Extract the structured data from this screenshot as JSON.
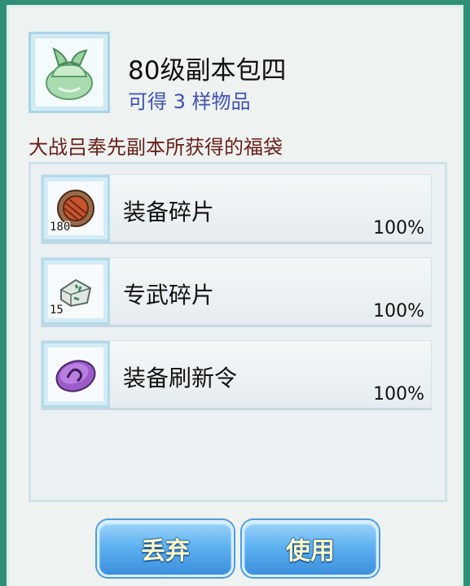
{
  "item": {
    "title": "80级副本包四",
    "count_text": "可得 3 样物品",
    "description": "大战吕奉先副本所获得的福袋",
    "icon": "green-cloth-bag-icon"
  },
  "rewards": [
    {
      "name": "装备碎片",
      "quantity": "180",
      "chance": "100%",
      "icon": "equipment-shard-icon"
    },
    {
      "name": "专武碎片",
      "quantity": "15",
      "chance": "100%",
      "icon": "exclusive-weapon-shard-icon"
    },
    {
      "name": "装备刷新令",
      "quantity": "",
      "chance": "100%",
      "icon": "equipment-refresh-token-icon"
    }
  ],
  "buttons": {
    "discard": "丢弃",
    "use": "使用"
  },
  "colors": {
    "frame": "#2f8f77",
    "panel": "#eef2f1",
    "description_text": "#6a1f18",
    "count_text": "#3f52b6",
    "button_blue": "#5fb2f0",
    "button_text": "#fff8c2"
  }
}
